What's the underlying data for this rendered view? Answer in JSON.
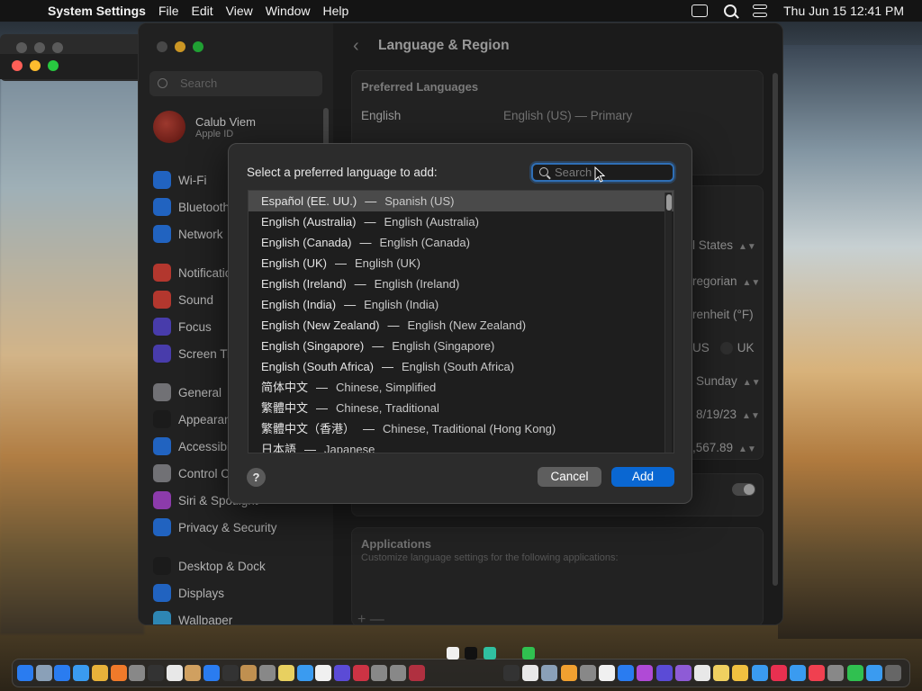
{
  "menubar": {
    "apple_glyph": "",
    "app_name": "System Settings",
    "menus": [
      "File",
      "Edit",
      "View",
      "Window",
      "Help"
    ],
    "clock": "Thu Jun 15  12:41 PM"
  },
  "settings": {
    "search_placeholder": "Search",
    "account": {
      "name": "Calub Viem",
      "sub": "Apple ID"
    },
    "sidebar_items": [
      {
        "label": "Wi-Fi",
        "icon": "wifi-icon",
        "color": "#2a7cf0"
      },
      {
        "label": "Bluetooth",
        "icon": "bluetooth-icon",
        "color": "#2a7cf0"
      },
      {
        "label": "Network",
        "icon": "globe-icon",
        "color": "#2a7cf0"
      },
      {
        "label": "Notifications",
        "icon": "bell-icon",
        "color": "#e0453a"
      },
      {
        "label": "Sound",
        "icon": "speaker-icon",
        "color": "#e0453a"
      },
      {
        "label": "Focus",
        "icon": "moon-icon",
        "color": "#5b4bd6"
      },
      {
        "label": "Screen Time",
        "icon": "hourglass-icon",
        "color": "#5b4bd6"
      },
      {
        "label": "General",
        "icon": "gear-icon",
        "color": "#8e8e93"
      },
      {
        "label": "Appearance",
        "icon": "appearance-icon",
        "color": "#222222"
      },
      {
        "label": "Accessibility",
        "icon": "accessibility-icon",
        "color": "#2a7cf0"
      },
      {
        "label": "Control Centre",
        "icon": "control-centre-icon",
        "color": "#8e8e93"
      },
      {
        "label": "Siri & Spotlight",
        "icon": "siri-icon",
        "color": "#b04ad6"
      },
      {
        "label": "Privacy & Security",
        "icon": "hand-icon",
        "color": "#2a7cf0"
      },
      {
        "label": "Desktop & Dock",
        "icon": "dock-icon",
        "color": "#222222"
      },
      {
        "label": "Displays",
        "icon": "display-icon",
        "color": "#2a7cf0"
      },
      {
        "label": "Wallpaper",
        "icon": "wallpaper-icon",
        "color": "#3aa8e0"
      }
    ],
    "page_title": "Language & Region",
    "preferred_languages_header": "Preferred Languages",
    "preferred_language": {
      "name": "English",
      "detail": "English (US) — Primary"
    },
    "region_values": {
      "region": "l States",
      "calendar": "regorian",
      "temperature": "renheit (°F)",
      "measurement_us": "US",
      "measurement_uk": "UK",
      "first_day": "Sunday",
      "date_format": "8/19/23",
      "number_format": ",567.89"
    },
    "applications": {
      "title": "Applications",
      "subtitle": "Customize language settings for the following applications:",
      "add_remove": "+ —"
    }
  },
  "sheet": {
    "prompt": "Select a preferred language to add:",
    "search_placeholder": "Search",
    "languages": [
      {
        "native": "Español (EE. UU.)",
        "english": "Spanish (US)"
      },
      {
        "native": "English (Australia)",
        "english": "English (Australia)"
      },
      {
        "native": "English (Canada)",
        "english": "English (Canada)"
      },
      {
        "native": "English (UK)",
        "english": "English (UK)"
      },
      {
        "native": "English (Ireland)",
        "english": "English (Ireland)"
      },
      {
        "native": "English (India)",
        "english": "English (India)"
      },
      {
        "native": "English (New Zealand)",
        "english": "English (New Zealand)"
      },
      {
        "native": "English (Singapore)",
        "english": "English (Singapore)"
      },
      {
        "native": "English (South Africa)",
        "english": "English (South Africa)"
      },
      {
        "native": "简体中文",
        "english": "Chinese, Simplified"
      },
      {
        "native": "繁體中文",
        "english": "Chinese, Traditional"
      },
      {
        "native": "繁體中文（香港）",
        "english": "Chinese, Traditional (Hong Kong)"
      },
      {
        "native": "日本語",
        "english": "Japanese"
      }
    ],
    "separator": "—",
    "help_label": "?",
    "cancel_label": "Cancel",
    "add_label": "Add"
  },
  "dock": {
    "icon_colors": [
      "#2a7cf0",
      "#8aa0b8",
      "#2a7cf0",
      "#3a9bf0",
      "#e8b23a",
      "#f07a2a",
      "#888888",
      "#333333",
      "#e8e8e8",
      "#d0a060",
      "#2a7cf0",
      "#333333",
      "#c09050",
      "#888888",
      "#e8d060",
      "#3a9bf0",
      "#f0f0f0",
      "#5b4bd6",
      "#cc3344",
      "#888888",
      "#888888",
      "#b03040"
    ],
    "right_icon_colors": [
      "#333333",
      "#e8e8e8",
      "#8aa0b8",
      "#f0a030",
      "#888888",
      "#f0f0f0",
      "#2a7cf0",
      "#b04ad6",
      "#5b4bd6",
      "#8e5bd6",
      "#e8e8e8",
      "#f0d060",
      "#f0c040",
      "#3a9bf0",
      "#e83050",
      "#3a9bf0",
      "#f04050",
      "#888888",
      "#30c050",
      "#3a9bf0",
      "#666666"
    ]
  }
}
